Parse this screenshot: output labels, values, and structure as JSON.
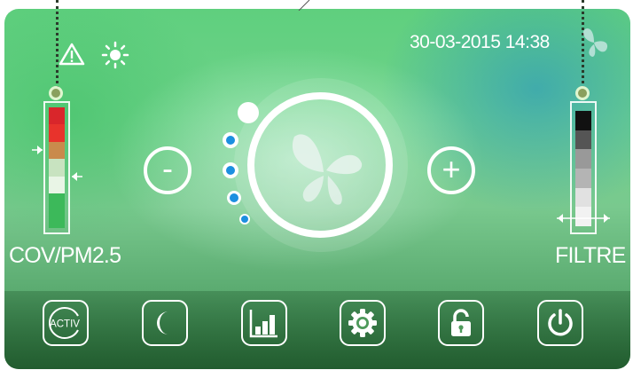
{
  "status": {
    "datetime": "30-03-2015 14:38",
    "icons": [
      "warning-icon",
      "sun-icon",
      "butterfly-icon"
    ]
  },
  "left_gauge": {
    "label": "COV/PM2.5",
    "segments": [
      "#d9262b",
      "#e8332c",
      "#c98a4c",
      "#c8e3c0",
      "#e9f5e6",
      "#3cb95a",
      "#3cb95a"
    ]
  },
  "right_gauge": {
    "label": "FILTRE",
    "segments": [
      "#111111",
      "#555555",
      "#999999",
      "#b4b4b4",
      "#e1e1e1",
      "#f2f2f2"
    ]
  },
  "fan": {
    "minus_label": "-",
    "plus_label": "+",
    "speed_levels": 4,
    "active_color": "#1c8fe0"
  },
  "toolbar": {
    "activ_label": "ACTIV",
    "buttons": [
      "activ-button",
      "night-mode-button",
      "stats-button",
      "settings-button",
      "lock-button",
      "power-button"
    ]
  }
}
